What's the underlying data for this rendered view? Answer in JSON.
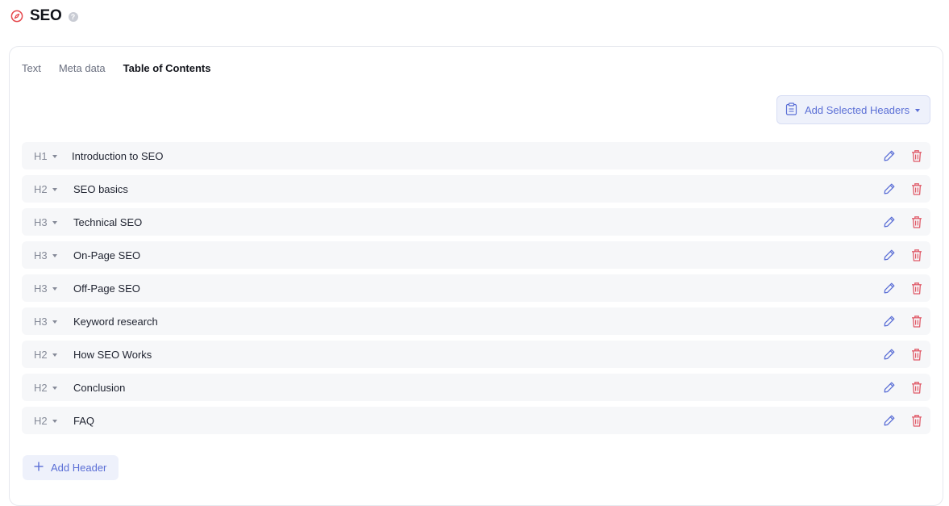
{
  "page": {
    "title": "SEO",
    "help_glyph": "?",
    "icons": {
      "logo": "compass-icon",
      "help": "help-icon"
    },
    "colors": {
      "logo": "#e5484d",
      "accent": "#5b6fd6",
      "danger": "#e05a68"
    }
  },
  "tabs": [
    {
      "label": "Text",
      "active": false
    },
    {
      "label": "Meta data",
      "active": false
    },
    {
      "label": "Table of Contents",
      "active": true
    }
  ],
  "toolbar": {
    "add_selected_label": "Add Selected Headers",
    "add_selected_icon": "clipboard-icon"
  },
  "headers": [
    {
      "level": "H1",
      "text": "Introduction to SEO"
    },
    {
      "level": "H2",
      "text": "SEO basics"
    },
    {
      "level": "H3",
      "text": "Technical SEO"
    },
    {
      "level": "H3",
      "text": "On-Page SEO"
    },
    {
      "level": "H3",
      "text": "Off-Page SEO"
    },
    {
      "level": "H3",
      "text": "Keyword research"
    },
    {
      "level": "H2",
      "text": "How SEO Works"
    },
    {
      "level": "H2",
      "text": "Conclusion"
    },
    {
      "level": "H2",
      "text": "FAQ"
    }
  ],
  "row_actions": {
    "edit_icon": "pencil-icon",
    "delete_icon": "trash-icon"
  },
  "footer": {
    "add_header_label": "Add Header",
    "add_header_icon": "plus-icon"
  }
}
